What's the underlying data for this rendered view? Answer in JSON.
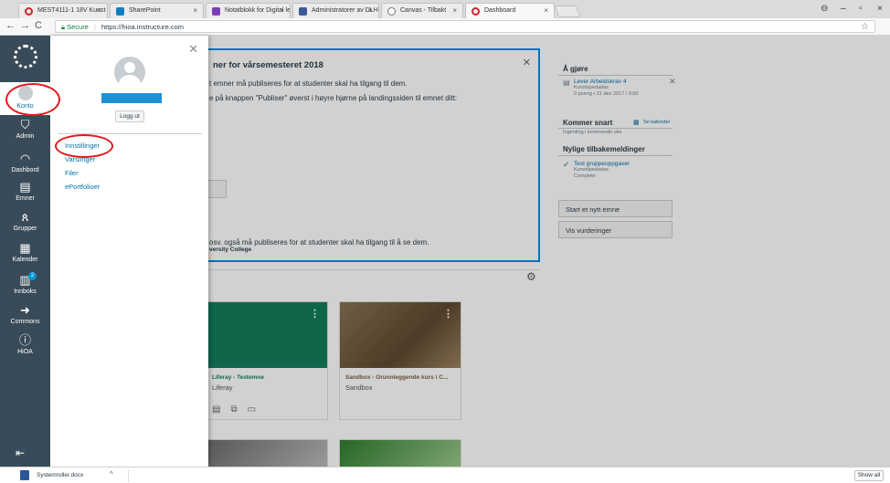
{
  "browser": {
    "tabs": [
      {
        "label": "MEST4111-1 18V Kunst",
        "icon": "canvas-icon"
      },
      {
        "label": "SharePoint",
        "icon": "sharepoint-icon"
      },
      {
        "label": "Notatblokk for Digital le",
        "icon": "onenote-icon"
      },
      {
        "label": "Administratorer av DLH",
        "icon": "facebook-icon"
      },
      {
        "label": "Canvas - Tilbakt",
        "icon": "page-icon"
      },
      {
        "label": "Dashboard",
        "icon": "canvas-icon"
      }
    ],
    "url_secure_label": "Secure",
    "url": "https://hioa.instructure.com"
  },
  "global_nav": {
    "items": [
      {
        "label": "Konto",
        "icon": "avatar"
      },
      {
        "label": "Admin",
        "icon": "shield-icon"
      },
      {
        "label": "Dashbord",
        "icon": "dashboard-icon"
      },
      {
        "label": "Emner",
        "icon": "book-icon"
      },
      {
        "label": "Grupper",
        "icon": "group-icon"
      },
      {
        "label": "Kalender",
        "icon": "calendar-icon"
      },
      {
        "label": "Innboks",
        "icon": "inbox-icon",
        "badge": "2"
      },
      {
        "label": "Commons",
        "icon": "commons-icon"
      },
      {
        "label": "HiOA",
        "icon": "info-icon"
      }
    ]
  },
  "account_tray": {
    "logout_label": "Logg ut",
    "links": [
      "Innstillinger",
      "Varslinger",
      "Filer",
      "ePortfolioer"
    ]
  },
  "notice": {
    "title": "ner for vårsemesteret 2018",
    "line1": "t emner må publiseres for at studenter skal ha tilgang til dem.",
    "line2": "e på knappen \"Publiser\" øverst i høyre hjørne på landingssiden til emnet ditt:",
    "line3": "osv. også må publiseres for at studenter skal ha tilgang til å se dem.",
    "footer": "versity College"
  },
  "cards": [
    {
      "title": "Liferay - Testemne",
      "subtitle": "Liferay",
      "color": "#137d5c"
    },
    {
      "title": "Sandbox - Grunnleggende kurs i C...",
      "subtitle": "Sandbox",
      "color": "#7a6141"
    }
  ],
  "sidebar": {
    "todo_heading": "Å gjøre",
    "todo_item": {
      "title": "Lever Arbeidskrav 4",
      "course": "Kunstspedadas",
      "meta": "0 poeng • 21 des 2017 / 9:00"
    },
    "coming_heading": "Kommer snart",
    "calendar_link": "Se kalender",
    "coming_empty": "Ingenting i kommende uke",
    "feedback_heading": "Nylige tilbakemeldinger",
    "feedback_item": {
      "title": "Test gruppeoppgaver",
      "course": "Kunstspedadas",
      "status": "Complete"
    },
    "new_course_button": "Start et nytt emne",
    "grades_button": "Vis vurderinger"
  },
  "downloads": {
    "file": "Systemroller.docx",
    "show_all": "Show all"
  },
  "colors": {
    "nav_bg": "#394b58",
    "link": "#0770a3",
    "annotation": "#e3181c",
    "highlight_box": "#008ee2"
  }
}
